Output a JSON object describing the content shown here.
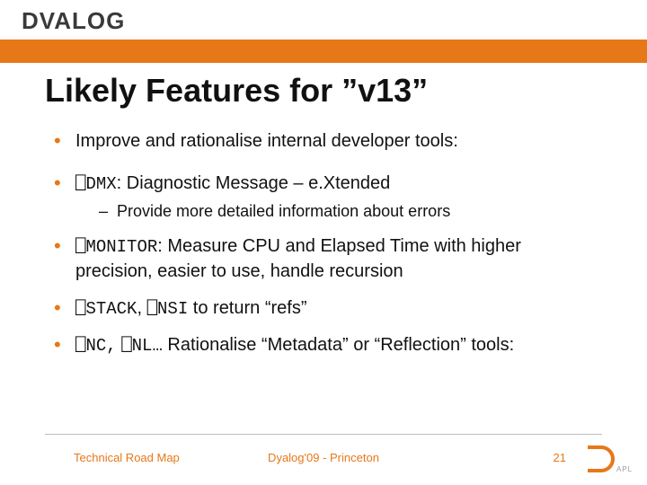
{
  "header": {
    "logo_text": "DVALOG"
  },
  "title": "Likely Features for ”v13”",
  "bullets": {
    "b1": "Improve and rationalise internal developer tools:",
    "b2_code": "⎕DMX",
    "b2_rest": ": Diagnostic Message – e.Xtended",
    "b2_sub": "Provide more detailed information about errors",
    "b3_code": "⎕MONITOR",
    "b3_rest": ": Measure CPU and Elapsed Time with higher precision, easier to use, handle recursion",
    "b4_code1": "⎕STACK",
    "b4_mid": ", ",
    "b4_code2": "⎕NSI",
    "b4_rest": " to return “refs”",
    "b5_code1": "⎕NC,",
    "b5_mid": " ",
    "b5_code2": "⎕NL…",
    "b5_rest": "  Rationalise “Metadata” or “Reflection” tools:"
  },
  "footer": {
    "left": "Technical Road Map",
    "center": "Dyalog'09 - Princeton",
    "page": "21",
    "badge": "APL"
  }
}
